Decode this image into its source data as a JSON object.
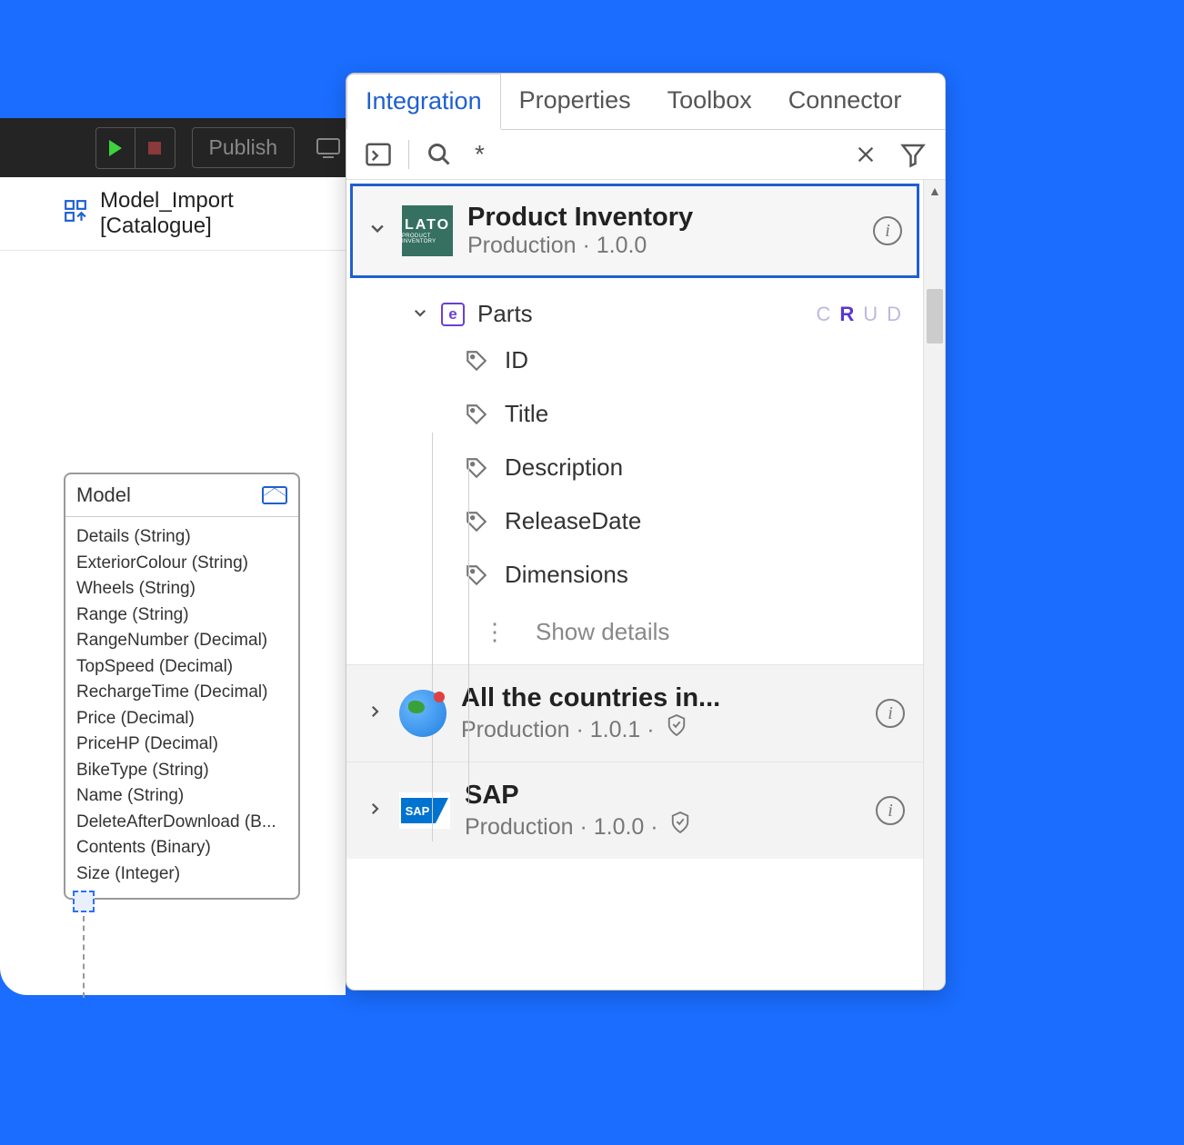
{
  "toolbar": {
    "publish_label": "Publish"
  },
  "import_tab": {
    "label": "Model_Import [Catalogue]"
  },
  "model_card": {
    "title": "Model",
    "attributes": [
      "Details (String)",
      "ExteriorColour (String)",
      "Wheels (String)",
      "Range (String)",
      "RangeNumber (Decimal)",
      "TopSpeed (Decimal)",
      "RechargeTime (Decimal)",
      "Price (Decimal)",
      "PriceHP (Decimal)",
      "BikeType (String)",
      "Name (String)",
      "DeleteAfterDownload (B...",
      "Contents (Binary)",
      "Size (Integer)"
    ]
  },
  "panel": {
    "tabs": [
      "Integration",
      "Properties",
      "Toolbox",
      "Connector"
    ],
    "active_tab": 0,
    "search_value": "*"
  },
  "integrations": [
    {
      "logo": "LATO",
      "title": "Product Inventory",
      "subtitle": "Production · 1.0.0",
      "expanded": true,
      "entity": {
        "name": "Parts",
        "crud": [
          "C",
          "R",
          "U",
          "D"
        ],
        "crud_active": "R",
        "attributes": [
          "ID",
          "Title",
          "Description",
          "ReleaseDate",
          "Dimensions"
        ],
        "show_details": "Show details"
      }
    },
    {
      "logo": "globe",
      "title": "All the countries in...",
      "subtitle": "Production · 1.0.1 ·",
      "shield": true,
      "expanded": false
    },
    {
      "logo": "sap",
      "title": "SAP",
      "subtitle": "Production · 1.0.0 ·",
      "shield": true,
      "expanded": false
    }
  ]
}
